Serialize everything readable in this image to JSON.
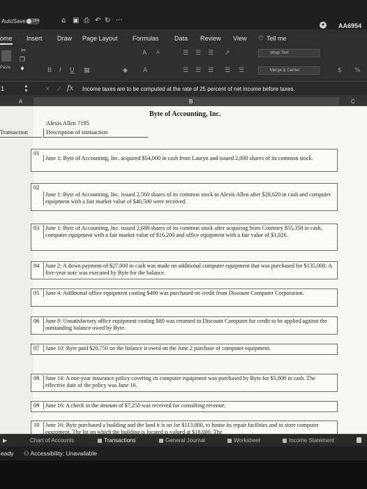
{
  "titlebar": {
    "autosave_label": "AutoSave",
    "autosave_state": "OFF",
    "account_name": "AA6954",
    "icons": [
      "home-icon",
      "save-icon",
      "undo-icon",
      "redo-icon",
      "more-icon"
    ],
    "more_glyph": "···"
  },
  "tabs": [
    "ome",
    "Insert",
    "Draw",
    "Page Layout",
    "Formulas",
    "Data",
    "Review",
    "View"
  ],
  "tell_me": "Tell me",
  "ribbon": {
    "paste_label": "Paste",
    "wrap_text": "Wrap Text",
    "merge_center": "Merge & Center",
    "bold": "B",
    "italic": "I",
    "underline": "U",
    "currency": "$",
    "percent": "%"
  },
  "formula_bar": {
    "name_box": "1",
    "fx": "fx",
    "content": "Income taxes are to be computed at the rate of 25 percent of net income before taxes."
  },
  "columns": {
    "a": "A",
    "b": "B",
    "c": "C"
  },
  "sheet": {
    "title": "Byte of Accounting, Inc.",
    "name": "Alexis Allen 7195",
    "header_transaction": "Transaction",
    "header_description": "Description of transaction",
    "transactions": [
      {
        "num": "01",
        "text": "June 1:  Byte of Accounting, Inc. acquired $54,000 in cash from Lauryn and issued 2,000 shares of its common stock."
      },
      {
        "num": "02",
        "text": "June 1:  Byte of Accounting, Inc. issued 2,560 shares of its common stock to Alexis Allen after $28,620 in cash and computer equipment with a fair market value of $40,500 were received."
      },
      {
        "num": "03",
        "text": "June 1:  Byte of Accounting, Inc. issued 2,688 shares of its common stock after acquiring from Courtney $55,350 in cash, computer equipment with a fair market value of $16,200 and office equipment with a fair value of $1,026."
      },
      {
        "num": "04",
        "text": "June 2:  A down payment of $27,000 in cash was made on additional computer equipment that was purchased for $135,000.  A five-year note was executed by Byte for the balance."
      },
      {
        "num": "05",
        "text": "June 4:  Additional office equipment costing $400 was purchased on credit from Discount Computer Corporation."
      },
      {
        "num": "06",
        "text": "June 8:  Unsatisfactory office equipment costing $80  was returned to Discount Computer for credit to be applied against the outstanding balance owed by Byte."
      },
      {
        "num": "07",
        "text": "June 10:  Byte paid $20,750 on the balance it owed on the June 2 purchase of computer equipment."
      },
      {
        "num": "08",
        "text": "June 14:  A one-year insurance policy covering its computer equipment was purchased by Byte for $5,808 in cash.  The effective date of the policy was June 16."
      },
      {
        "num": "09",
        "text": "June 16:  A check in the amount of $7,250 was received for consulting revenue."
      },
      {
        "num": "10",
        "text": "June 16:  Byte purchased a building and the land it is on for $113,000, to house its repair facilities and to store computer equipment.  The lot on which the building is located is valued at $18,000.  The"
      }
    ]
  },
  "sheet_tabs": [
    "Chart of Accounts",
    "Transactions",
    "General Journal",
    "Worksheet",
    "Income Statement"
  ],
  "status": {
    "ready": "eady",
    "accessibility": "Accessibility: Unavailable"
  }
}
